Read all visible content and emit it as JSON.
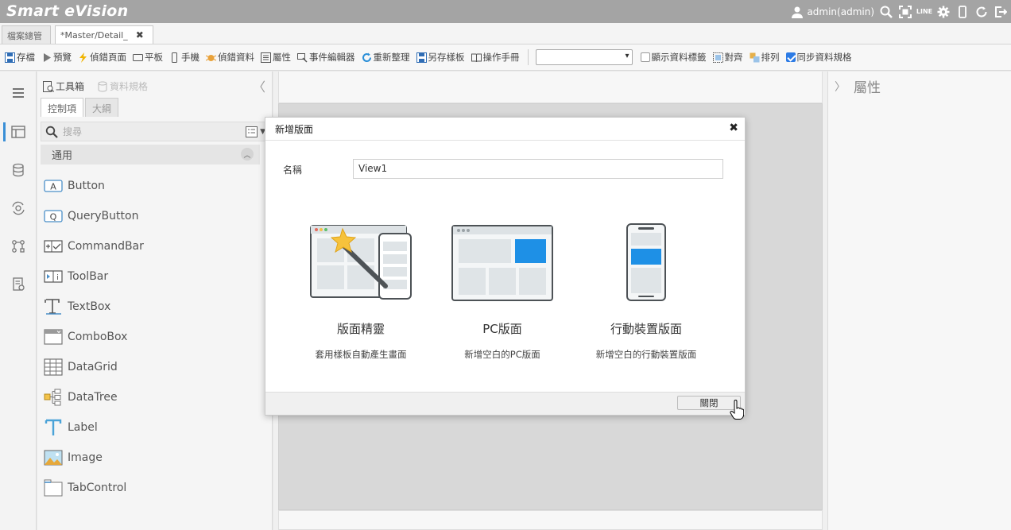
{
  "app": {
    "title": "Smart eVision",
    "user": "admin(admin)",
    "line_label": "LINE"
  },
  "tabs": [
    {
      "label": "檔案總管"
    },
    {
      "label": "*Master/Detail_",
      "close": "✖"
    }
  ],
  "toolbar": {
    "buttons": [
      {
        "icon": "save-icon",
        "label": "存檔"
      },
      {
        "icon": "play-icon",
        "label": "預覽"
      },
      {
        "icon": "lightning-icon",
        "label": "偵錯頁面"
      },
      {
        "icon": "tablet-icon",
        "label": "平板"
      },
      {
        "icon": "phone-icon",
        "label": "手機"
      },
      {
        "icon": "bug-icon",
        "label": "偵錯資料"
      },
      {
        "icon": "properties-icon",
        "label": "屬性"
      },
      {
        "icon": "event-editor-icon",
        "label": "事件編輯器"
      },
      {
        "icon": "refresh-icon",
        "label": "重新整理"
      },
      {
        "icon": "save-as-template-icon",
        "label": "另存樣板"
      },
      {
        "icon": "book-icon",
        "label": "操作手冊"
      }
    ],
    "select_value": "",
    "show_data_labels": "顯示資料標籤",
    "align": "對齊",
    "arrange": "排列",
    "sync_schema": "同步資料規格"
  },
  "left_panel": {
    "toolbox": "工具箱",
    "data_spec": "資料規格",
    "tab_controls": "控制項",
    "tab_outline": "大綱",
    "search_placeholder": "搜尋",
    "group": "通用",
    "controls": [
      {
        "label": "Button",
        "icon": "button-control-icon"
      },
      {
        "label": "QueryButton",
        "icon": "query-button-icon"
      },
      {
        "label": "CommandBar",
        "icon": "commandbar-icon"
      },
      {
        "label": "ToolBar",
        "icon": "toolbar-icon"
      },
      {
        "label": "TextBox",
        "icon": "textbox-icon"
      },
      {
        "label": "ComboBox",
        "icon": "combobox-icon"
      },
      {
        "label": "DataGrid",
        "icon": "datagrid-icon"
      },
      {
        "label": "DataTree",
        "icon": "datatree-icon"
      },
      {
        "label": "Label",
        "icon": "label-icon"
      },
      {
        "label": "Image",
        "icon": "image-icon"
      },
      {
        "label": "TabControl",
        "icon": "tabcontrol-icon"
      }
    ]
  },
  "right_panel": {
    "title": "屬性"
  },
  "modal": {
    "title": "新增版面",
    "close_icon": "✖",
    "name_label": "名稱",
    "name_value": "View1",
    "options": [
      {
        "title": "版面精靈",
        "desc": "套用樣板自動產生畫面"
      },
      {
        "title": "PC版面",
        "desc": "新增空白的PC版面"
      },
      {
        "title": "行動裝置版面",
        "desc": "新增空白的行動裝置版面"
      }
    ],
    "close_button": "關閉"
  },
  "colors": {
    "accent": "#1e90e6",
    "titlebar": "#a4a4a4",
    "art_gray": "#e3e8ec",
    "art_outline": "#4d5256"
  }
}
